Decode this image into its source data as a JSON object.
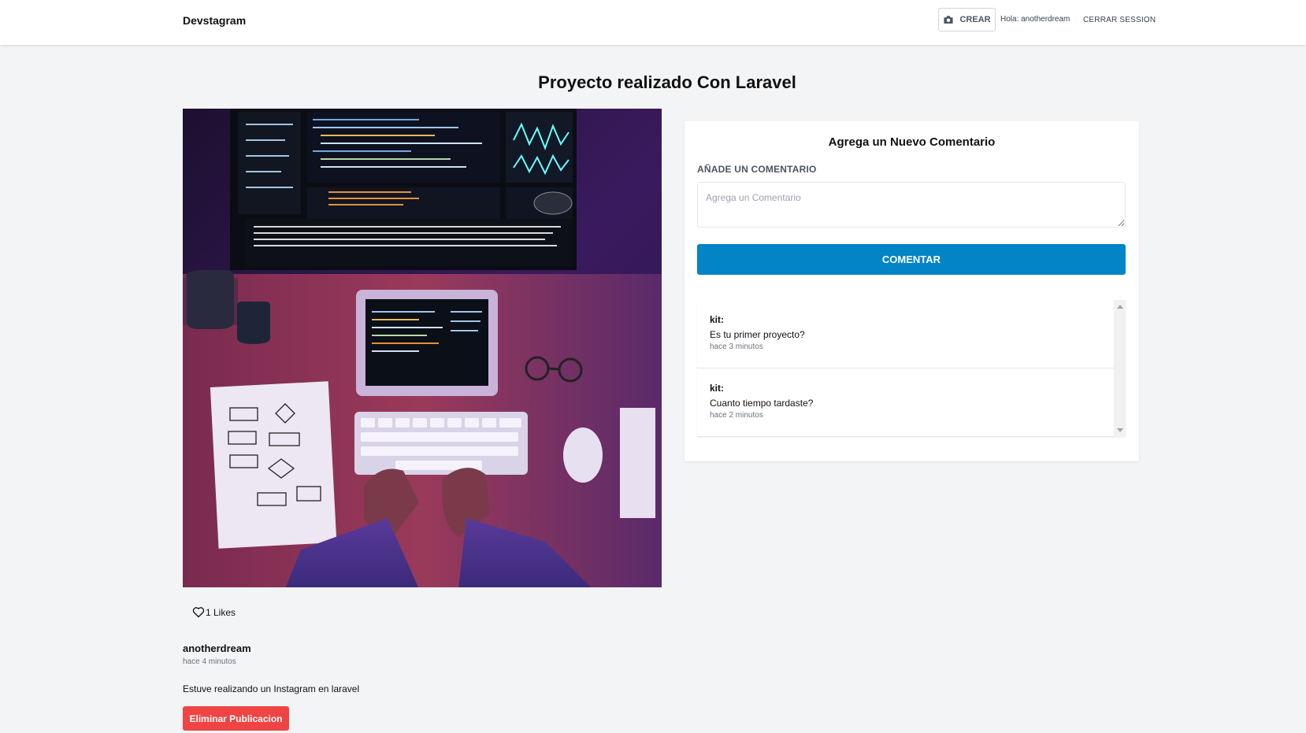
{
  "header": {
    "logo": "Devstagram",
    "create_label": "CREAR",
    "greeting": "Hola: anotherdream",
    "logout_label": "CERRAR SESSION"
  },
  "post": {
    "title": "Proyecto realizado Con Laravel",
    "likes_label": "1 Likes",
    "author": "anotherdream",
    "posted_time": "hace 4 minutos",
    "description": "Estuve realizando un Instagram en laravel",
    "delete_label": "Eliminar Publicacion"
  },
  "comment_form": {
    "title": "Agrega un Nuevo Comentario",
    "field_label": "Añade un Comentario",
    "placeholder": "Agrega un Comentario",
    "value": "",
    "submit_label": "COMENTAR"
  },
  "comments": [
    {
      "user": "kit:",
      "text": "Es tu primer proyecto?",
      "time": "hace 3 minutos"
    },
    {
      "user": "kit:",
      "text": "Cuanto tiempo tardaste?",
      "time": "hace 2 minutos"
    }
  ],
  "icons": {
    "create": "camera-icon",
    "like": "heart-icon"
  },
  "colors": {
    "primary": "#0284c7",
    "danger": "#ef4444",
    "background": "#f3f4f6"
  }
}
